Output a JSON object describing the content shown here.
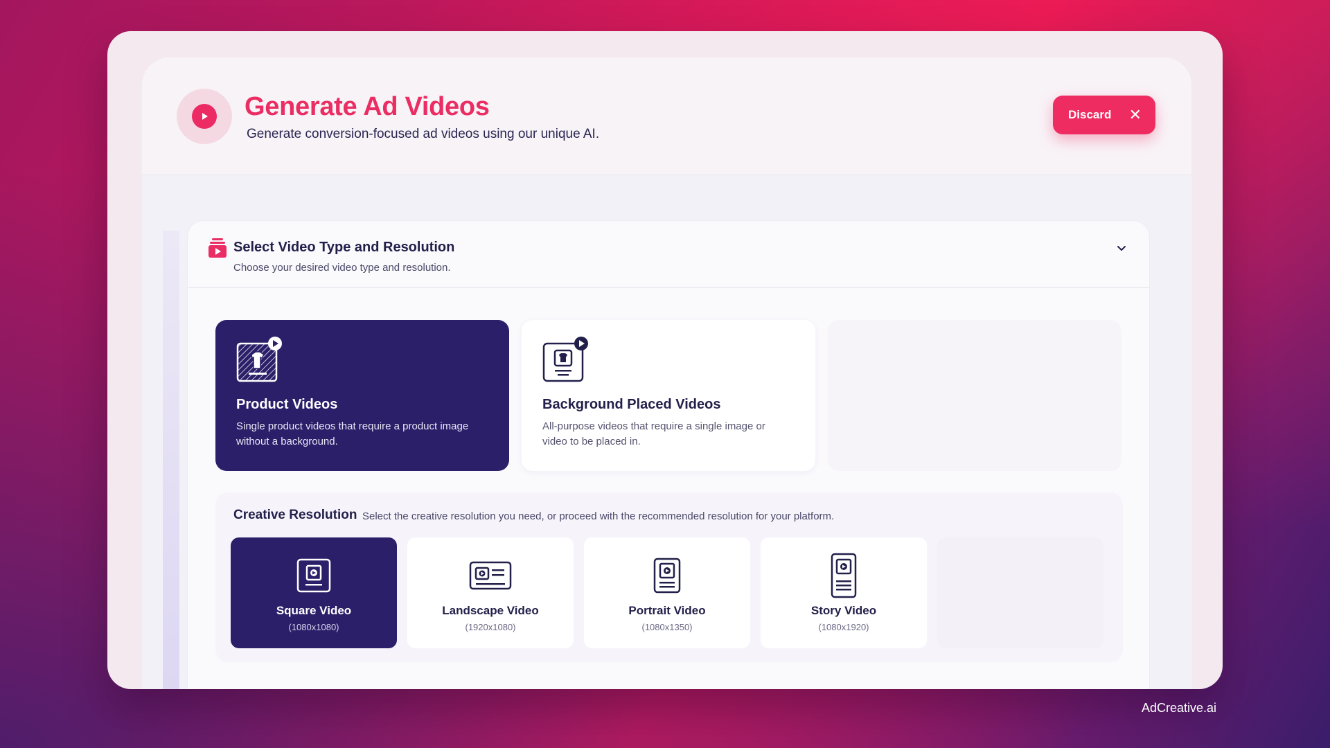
{
  "header": {
    "title": "Generate Ad Videos",
    "subtitle": "Generate conversion-focused ad videos using our unique AI.",
    "discard_label": "Discard",
    "discard_icon": "close-icon",
    "header_icon": "play-icon"
  },
  "section": {
    "title": "Select Video Type and Resolution",
    "subtitle": "Choose your desired video type and resolution.",
    "icon": "video-stack-icon",
    "toggle_icon": "chevron-down-icon"
  },
  "video_types": [
    {
      "name": "Product Videos",
      "description": "Single product videos that require a product image without a background.",
      "selected": true,
      "icon": "product-video-icon"
    },
    {
      "name": "Background Placed Videos",
      "description": "All-purpose videos that require a single image or video to be placed in.",
      "selected": false,
      "icon": "background-video-icon"
    }
  ],
  "resolution": {
    "title": "Creative Resolution",
    "description": "Select the creative resolution you need, or proceed with the recommended resolution for your platform.",
    "options": [
      {
        "name": "Square Video",
        "size": "(1080x1080)",
        "selected": true,
        "icon": "square-video-icon"
      },
      {
        "name": "Landscape Video",
        "size": "(1920x1080)",
        "selected": false,
        "icon": "landscape-video-icon"
      },
      {
        "name": "Portrait Video",
        "size": "(1080x1350)",
        "selected": false,
        "icon": "portrait-video-icon"
      },
      {
        "name": "Story Video",
        "size": "(1080x1920)",
        "selected": false,
        "icon": "story-video-icon"
      }
    ]
  },
  "watermark": "AdCreative.ai",
  "colors": {
    "accent": "#ea2d63",
    "primary_dark": "#2a1f68",
    "text_dark": "#22204a"
  }
}
